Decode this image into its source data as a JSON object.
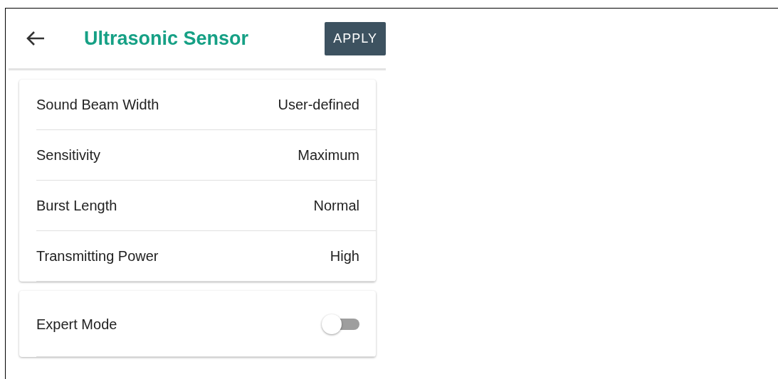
{
  "header": {
    "title": "Ultrasonic Sensor",
    "action": "APPLY"
  },
  "settings": [
    {
      "label": "Sound Beam Width",
      "value": "User-defined"
    },
    {
      "label": "Sensitivity",
      "value": "Maximum"
    },
    {
      "label": "Burst Length",
      "value": "Normal"
    },
    {
      "label": "Transmitting Power",
      "value": "High"
    }
  ],
  "expert_mode": {
    "label": "Expert Mode",
    "on": false
  }
}
